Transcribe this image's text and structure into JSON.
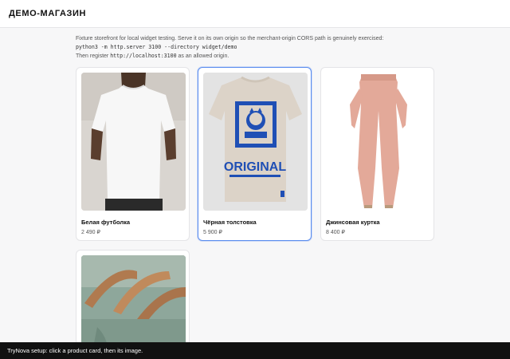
{
  "header": {
    "title": "ДЕМО-МАГАЗИН"
  },
  "intro": {
    "line1": "Fixture storefront for local widget testing. Serve it on its own origin so the merchant-origin CORS path is genuinely exercised:",
    "command": "python3 -m http.server 3100 --directory widget/demo",
    "line3_before": "Then register ",
    "origin": "http://localhost:3100",
    "line3_after": " as an allowed origin."
  },
  "products": [
    {
      "name": "Белая футболка",
      "price": "2 490 ₽",
      "image_icon": "white-tshirt-image"
    },
    {
      "name": "Чёрная толстовка",
      "price": "5 900 ₽",
      "image_icon": "original-tshirt-image",
      "selected": true,
      "print_text": "ORIGINAL"
    },
    {
      "name": "Джинсовая куртка",
      "price": "8 400 ₽",
      "image_icon": "pink-pants-image"
    },
    {
      "name": "",
      "price": "",
      "image_icon": "hangers-image"
    }
  ],
  "toast": {
    "text": "TryNova setup: click a product card, then its image."
  },
  "colors": {
    "accent": "#5b8def",
    "toast_bg": "#111111",
    "print_blue": "#1f4fb5"
  }
}
